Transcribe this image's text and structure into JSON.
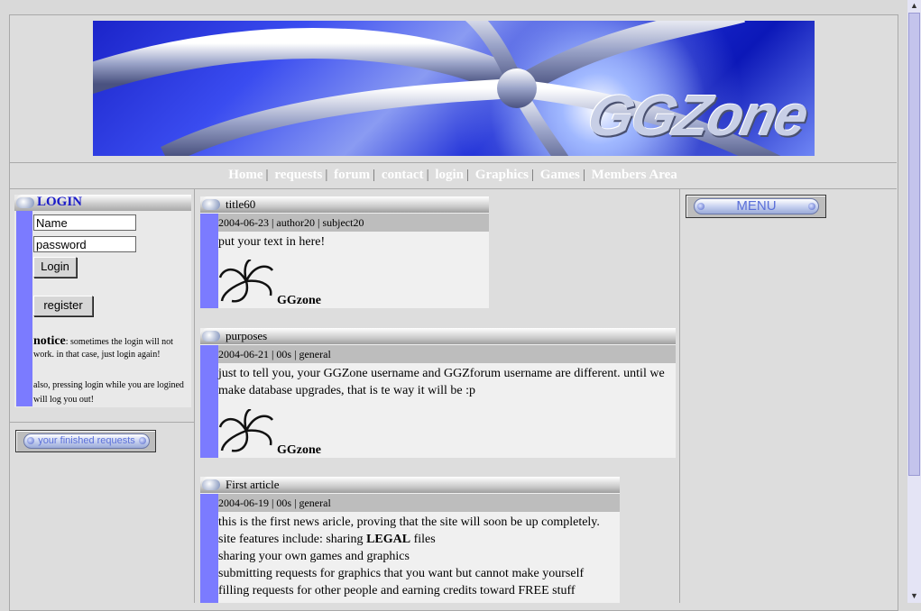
{
  "banner": {
    "logo_text": "GGZone"
  },
  "nav": {
    "items": [
      "Home",
      "requests",
      "forum",
      "contact",
      "login",
      "Graphics",
      "Games",
      "Members Area"
    ]
  },
  "login": {
    "title": "LOGIN",
    "name_value": "Name",
    "password_value": "password",
    "login_button": "Login",
    "register_button": "register",
    "notice_label": "notice",
    "notice_text": ": sometimes the login will not work. in that case, just login again!",
    "notice2_text": "also, pressing login while you are logined will log you out!"
  },
  "finished_requests": "your finished requests",
  "menu": "MENU",
  "articles": [
    {
      "title": "title60",
      "meta": "2004-06-23 | author20 | subject20",
      "body": [
        "put your text in here!"
      ],
      "signature": "GGzone"
    },
    {
      "title": "purposes",
      "meta": "2004-06-21 | 00s | general",
      "body": [
        "just to tell you, your GGZone username and GGZforum username are different. until we make database upgrades, that is te way it will be :p"
      ],
      "signature": "GGzone"
    },
    {
      "title": "First article",
      "meta": "2004-06-19 | 00s | general",
      "body_intro": "this is the first news aricle, proving that the site will soon be up completely.",
      "body_features_pre": "site features include: sharing ",
      "body_features_bold": "LEGAL",
      "body_features_post": " files",
      "body_lines": [
        "sharing your own games and graphics",
        "submitting requests for graphics that you want but cannot make yourself",
        "filling requests for other people and earning credits toward FREE stuff"
      ]
    }
  ],
  "colors": {
    "accent_blue": "#7b7bff",
    "title_blue": "#1a1ac8"
  }
}
